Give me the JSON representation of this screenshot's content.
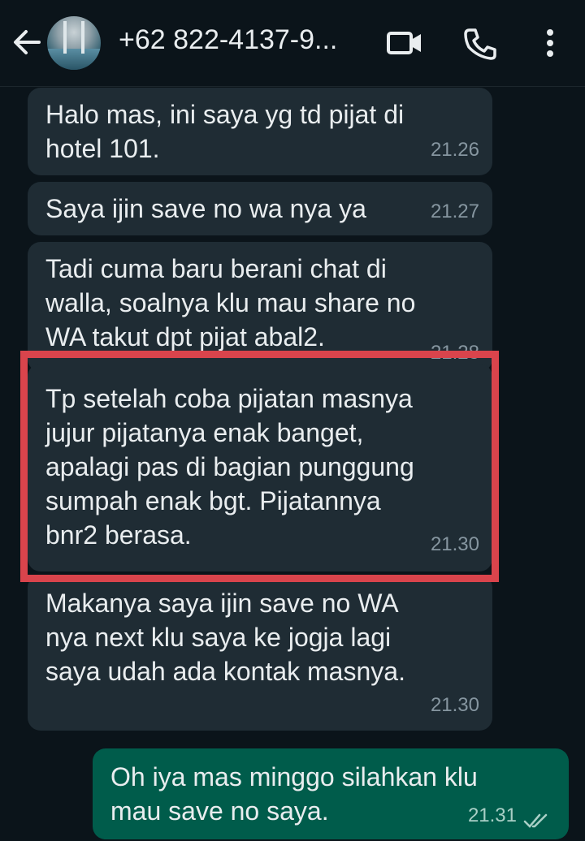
{
  "header": {
    "back_icon": "arrow-left-icon",
    "contact_name": "+62 822-4137-9...",
    "video_icon": "video-call-icon",
    "call_icon": "phone-icon",
    "more_icon": "more-vert-icon"
  },
  "messages": [
    {
      "text": "Halo mas, ini saya yg td pijat di\nhotel 101.",
      "time": "21.26",
      "direction": "in"
    },
    {
      "text": "Saya ijin save no wa nya ya",
      "time": "21.27",
      "direction": "in"
    },
    {
      "text": "Tadi cuma baru berani chat di\nwalla, soalnya klu mau share no\nWA takut dpt pijat abal2.",
      "time": "21.28",
      "direction": "in"
    },
    {
      "text": "Tp setelah coba pijatan masnya\njujur pijatanya enak banget,\napalagi pas di bagian punggung\nsumpah enak bgt. Pijatannya\nbnr2 berasa.",
      "time": "21.30",
      "direction": "in",
      "highlighted": true
    },
    {
      "text": "Makanya saya ijin save no WA\nnya next klu saya ke jogja lagi\nsaya udah ada kontak masnya.",
      "time": "21.30",
      "direction": "in"
    },
    {
      "text": "Oh iya mas minggo silahkan klu\nmau save no saya.",
      "time": "21.31",
      "direction": "out",
      "status": "read"
    }
  ],
  "colors": {
    "background": "#0b141a",
    "incoming_bubble": "#1f2c34",
    "outgoing_bubble": "#005c4b",
    "highlight_border": "#d9444c"
  }
}
